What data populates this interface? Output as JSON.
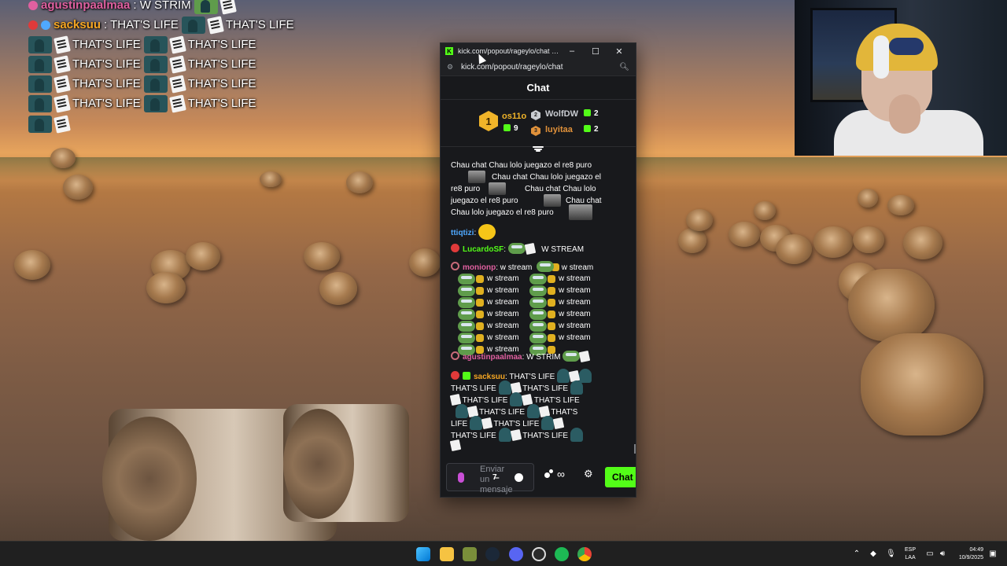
{
  "overlay_chat": {
    "row1_user": "agustinpaalmaa",
    "row1_text": ": W STRIM",
    "row2_user": "sacksuu",
    "row2_text": ": THAT'S LIFE",
    "phrase": "THAT'S LIFE"
  },
  "browser": {
    "title": "kick.com/popout/rageylo/chat - Goog...",
    "url": "kick.com/popout/rageylo/chat",
    "minimize": "–",
    "maximize": "☐",
    "close": "✕"
  },
  "chat": {
    "header": "Chat",
    "leaderboard": [
      {
        "rank": "1",
        "name": "os11o",
        "count": "9",
        "color": "#f0b429"
      },
      {
        "rank": "2",
        "name": "WolfDW",
        "count": "2",
        "color": "#c9ccd1"
      },
      {
        "rank": "3",
        "name": "luyitaa",
        "count": "2",
        "color": "#e0913a"
      }
    ],
    "messages": {
      "chau_lines": [
        "Chau chat Chau lolo juegazo el re8 puro",
        "Chau chat Chau lolo juegazo el",
        "re8 puro",
        "Chau chat Chau lolo",
        "juegazo el re8 puro",
        "Chau chat",
        "Chau lolo juegazo el re8 puro"
      ],
      "ttiqtizi_user": "ttiqtizi",
      "lucardo_user": "LucardoSF",
      "lucardo_text": "W STREAM",
      "monionp_user": "monionp",
      "monionp_text": "w stream",
      "ws_word": "w stream",
      "agustin_user": "agustinpaalmaa",
      "agustin_text": "W STRIM",
      "sacksuu_user": "sacksuu",
      "sacksuu_text": "THAT'S LIFE",
      "life_word": "THAT'S LIFE",
      "life_split_a": "THAT'S",
      "life_split_b": "LIFE"
    },
    "input_placeholder": "Enviar un mensaje",
    "send_label": "Chat"
  },
  "colors": {
    "kick_green": "#53fc18",
    "user_pink": "#e060a0",
    "user_blue": "#4fa9ff",
    "user_green": "#53fc18",
    "user_orange": "#f5a623"
  },
  "taskbar": {
    "lang_top": "ESP",
    "lang_bottom": "LAA",
    "time": "04:49",
    "date": "10/9/2025"
  }
}
